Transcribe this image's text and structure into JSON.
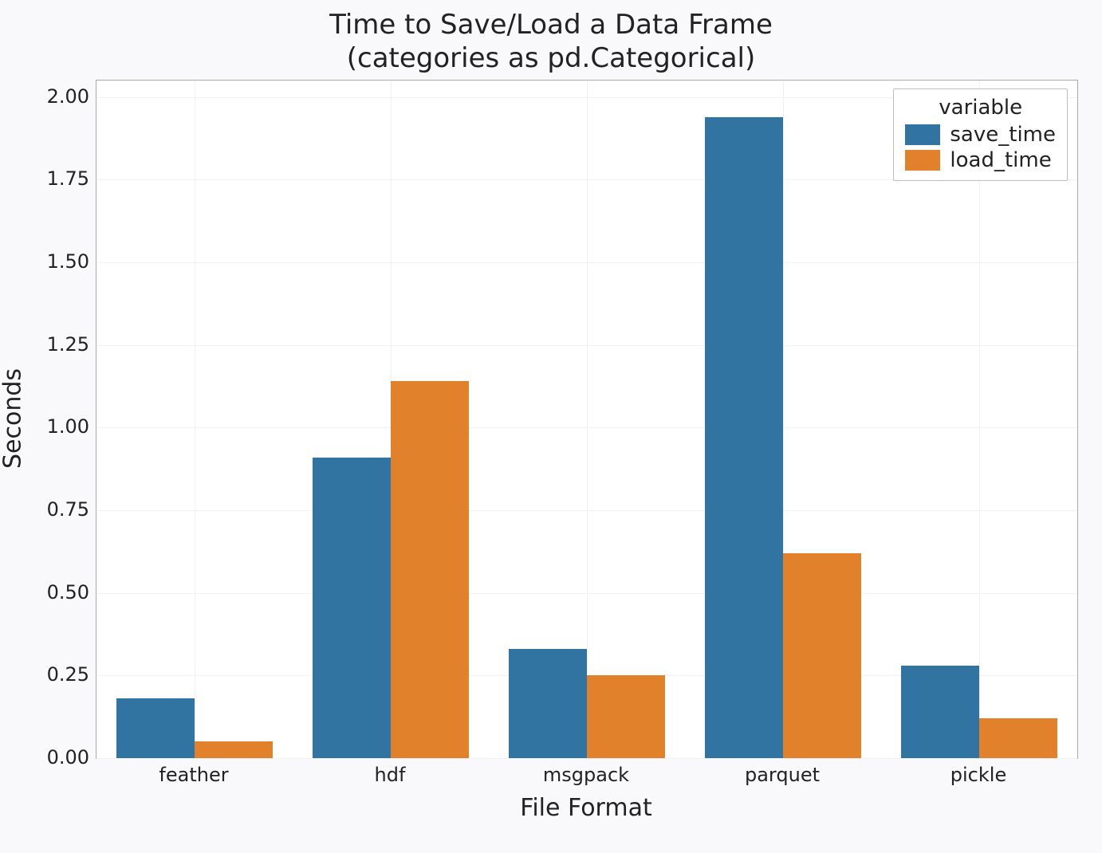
{
  "chart_data": {
    "type": "bar",
    "title_line1": "Time to Save/Load a Data Frame",
    "title_line2": "(categories as pd.Categorical)",
    "xlabel": "File Format",
    "ylabel": "Seconds",
    "categories": [
      "feather",
      "hdf",
      "msgpack",
      "parquet",
      "pickle"
    ],
    "series": [
      {
        "name": "save_time",
        "color": "#3274a1",
        "values": [
          0.18,
          0.91,
          0.33,
          1.94,
          0.28
        ]
      },
      {
        "name": "load_time",
        "color": "#e1812c",
        "values": [
          0.05,
          1.14,
          0.25,
          0.62,
          0.12
        ]
      }
    ],
    "yticks": [
      0.0,
      0.25,
      0.5,
      0.75,
      1.0,
      1.25,
      1.5,
      1.75,
      2.0
    ],
    "ylim": [
      0.0,
      2.05
    ],
    "legend_title": "variable",
    "legend_position": "upper right",
    "grid": true
  }
}
